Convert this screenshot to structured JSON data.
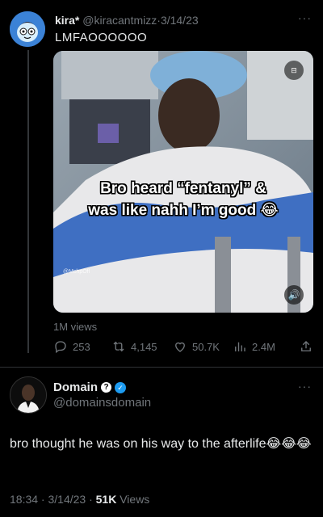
{
  "tweet1": {
    "name": "kira*",
    "handle": "@kiracantmizz",
    "separator": "·",
    "date": "3/14/23",
    "text": "LMFAOOOOOO",
    "more": "···",
    "media": {
      "caption_line1": "Bro heard “fentanyl” &",
      "caption_line2": "was like nahh I’m good 😂",
      "watermark": "@MchpOfl",
      "gif_icon": "gif-icon",
      "speaker_icon": "speaker-icon"
    },
    "views": "1M views",
    "stats": {
      "replies": "253",
      "retweets": "4,145",
      "likes": "50.7K",
      "views": "2.4M"
    }
  },
  "tweet2": {
    "name": "Domain",
    "handle": "@domainsdomain",
    "more": "···",
    "text": "bro thought he was on his way to the afterlife😂😂😂",
    "time": "18:34 · 3/14/23 · ",
    "views_count": "51K",
    "views_label": " Views"
  },
  "colors": {
    "background": "#000000",
    "text": "#e7e9ea",
    "muted": "#71767b",
    "verified": "#1d9bf0"
  }
}
